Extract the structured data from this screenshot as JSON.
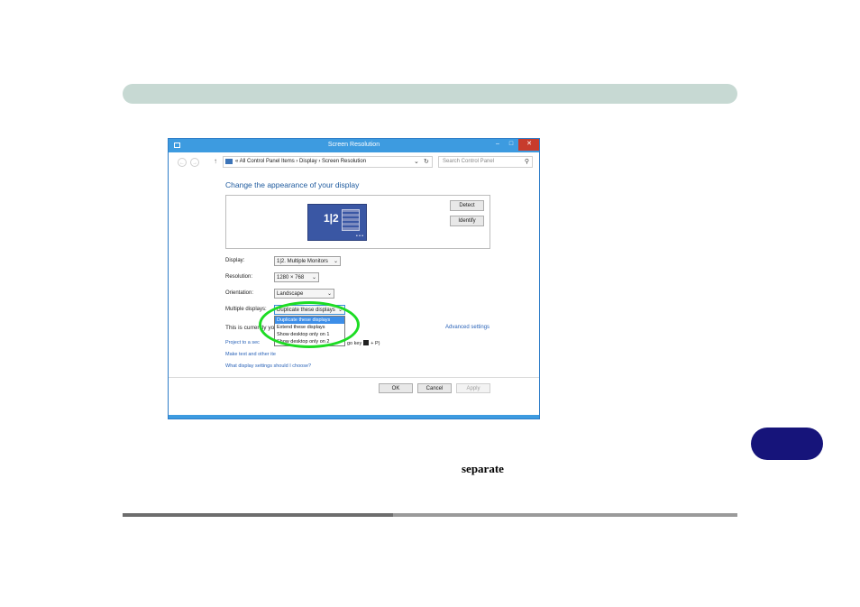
{
  "page": {
    "body_word": "separate"
  },
  "window": {
    "title": "Screen Resolution",
    "minimize_glyph": "–",
    "maximize_glyph": "□",
    "close_glyph": "✕",
    "nav": {
      "back_glyph": "←",
      "forward_glyph": "→",
      "up_glyph": "↑",
      "breadcrumb": "«  All Control Panel Items  ›  Display  ›  Screen Resolution",
      "dropdown_glyph": "⌄",
      "refresh_glyph": "↻",
      "search_placeholder": "Search Control Panel",
      "search_glyph": "⚲"
    },
    "heading": "Change the appearance of your display",
    "monitor_badge": "1|2",
    "monitor_dots": "• • •",
    "detect_label": "Detect",
    "identify_label": "Identify",
    "fields": {
      "display_label": "Display:",
      "display_value": "1|2. Multiple Monitors",
      "resolution_label": "Resolution:",
      "resolution_value": "1280 × 768",
      "orientation_label": "Orientation:",
      "orientation_value": "Landscape",
      "multiple_label": "Multiple displays:",
      "multiple_value": "Duplicate these displays"
    },
    "dropdown_options": [
      "Duplicate these displays",
      "Extend these displays",
      "Show desktop only on 1",
      "Show desktop only on 2"
    ],
    "current_text": "This is currently you",
    "key_text_before": "go key",
    "key_text_after": "+ P)",
    "advanced_link": "Advanced settings",
    "links": [
      "Project to a sec",
      "Make text and other ite",
      "What display settings should I choose?"
    ],
    "ok_label": "OK",
    "cancel_label": "Cancel",
    "apply_label": "Apply",
    "chevron_glyph": "⌄",
    "colors": {
      "accent": "#3d9be0",
      "highlight_ring": "#1ddc24",
      "link": "#2a63b8"
    }
  }
}
